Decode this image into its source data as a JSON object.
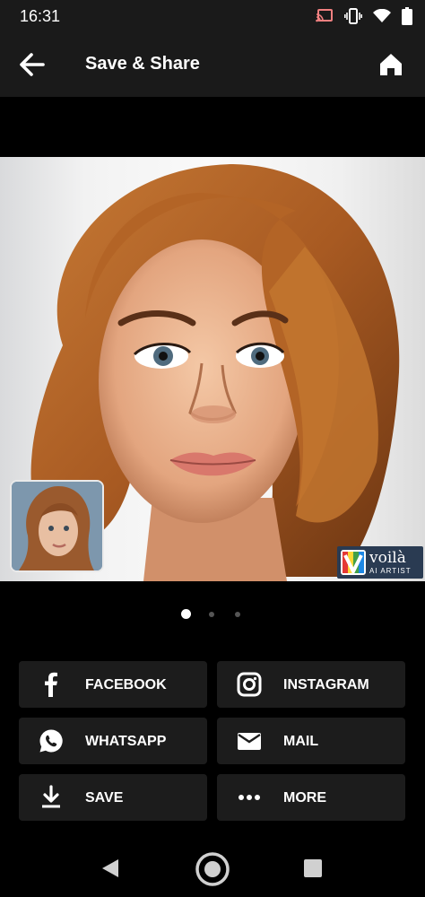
{
  "status_bar": {
    "time": "16:31"
  },
  "app_bar": {
    "title": "Save & Share"
  },
  "watermark": {
    "brand": "voilà",
    "tagline": "AI ARTIST"
  },
  "pager": {
    "count": 3,
    "active_index": 0
  },
  "share_buttons": [
    {
      "label": "FACEBOOK",
      "icon": "facebook-icon"
    },
    {
      "label": "INSTAGRAM",
      "icon": "instagram-icon"
    },
    {
      "label": "WHATSAPP",
      "icon": "whatsapp-icon"
    },
    {
      "label": "MAIL",
      "icon": "mail-icon"
    },
    {
      "label": "SAVE",
      "icon": "download-icon"
    },
    {
      "label": "MORE",
      "icon": "more-icon"
    }
  ],
  "colors": {
    "background": "#000000",
    "bar": "#1a1a1a",
    "button": "#1c1c1c",
    "text": "#ffffff"
  }
}
